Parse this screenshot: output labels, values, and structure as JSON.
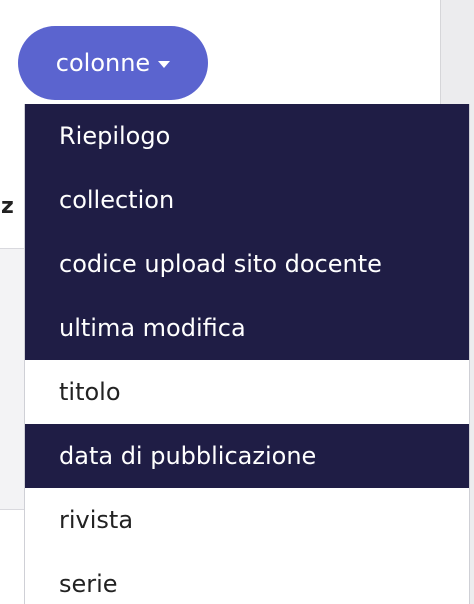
{
  "columns_button": {
    "label": "colonne"
  },
  "dropdown": {
    "items": [
      {
        "label": "Riepilogo",
        "selected": true
      },
      {
        "label": "collection",
        "selected": true
      },
      {
        "label": "codice upload sito docente",
        "selected": true
      },
      {
        "label": "ultima modifica",
        "selected": true
      },
      {
        "label": "titolo",
        "selected": false
      },
      {
        "label": "data di pubblicazione",
        "selected": true
      },
      {
        "label": "rivista",
        "selected": false
      },
      {
        "label": "serie",
        "selected": false
      }
    ]
  },
  "background": {
    "partial_header_letter": "z"
  },
  "colors": {
    "button": "#5b64cf",
    "selected_item": "#1f1d45",
    "selected_text": "#ffffff",
    "unselected_text": "#222222"
  }
}
